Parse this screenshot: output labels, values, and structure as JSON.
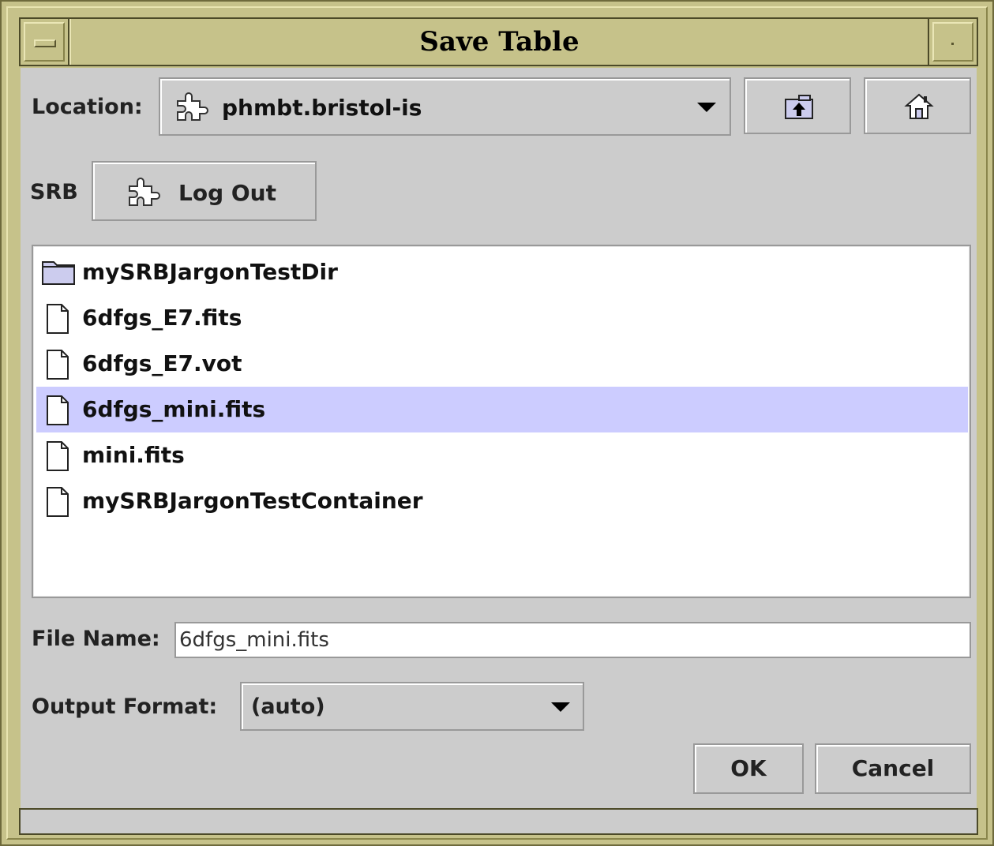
{
  "window": {
    "title": "Save Table"
  },
  "location": {
    "label": "Location:",
    "value": "phmbt.bristol-is",
    "value_icon": "puzzle-icon",
    "up_button_icon": "folder-up-icon",
    "home_button_icon": "home-icon"
  },
  "srb": {
    "label": "SRB",
    "logout_label": "Log Out",
    "logout_icon": "puzzle-icon"
  },
  "files": [
    {
      "name": "mySRBJargonTestDir",
      "type": "folder",
      "selected": false
    },
    {
      "name": "6dfgs_E7.fits",
      "type": "file",
      "selected": false
    },
    {
      "name": "6dfgs_E7.vot",
      "type": "file",
      "selected": false
    },
    {
      "name": "6dfgs_mini.fits",
      "type": "file",
      "selected": true
    },
    {
      "name": "mini.fits",
      "type": "file",
      "selected": false
    },
    {
      "name": "mySRBJargonTestContainer",
      "type": "file",
      "selected": false
    }
  ],
  "file_name": {
    "label": "File Name:",
    "value": "6dfgs_mini.fits"
  },
  "output_format": {
    "label": "Output Format:",
    "value": "(auto)"
  },
  "buttons": {
    "ok": "OK",
    "cancel": "Cancel"
  },
  "colors": {
    "title_bar": "#c6c28a",
    "panel": "#cccccc",
    "selection": "#ccccff"
  }
}
